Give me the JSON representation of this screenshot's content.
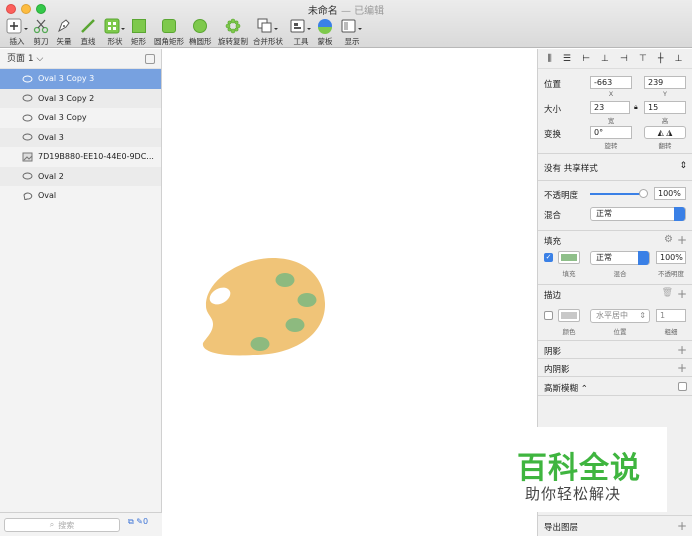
{
  "window": {
    "title": "未命名",
    "edited": "— 已编辑"
  },
  "toolbar": {
    "items": [
      "插入",
      "剪刀",
      "矢量",
      "直线",
      "形状",
      "矩形",
      "圆角矩形",
      "椭圆形",
      "旋转复制",
      "合并形状",
      "工具",
      "蒙板",
      "显示"
    ]
  },
  "layers": {
    "page": "页面 1",
    "items": [
      {
        "name": "Oval 3 Copy 3",
        "icon": "oval-icon",
        "selected": true
      },
      {
        "name": "Oval 3 Copy 2",
        "icon": "oval-icon"
      },
      {
        "name": "Oval 3 Copy",
        "icon": "oval-icon"
      },
      {
        "name": "Oval 3",
        "icon": "oval-icon"
      },
      {
        "name": "7D19B880-EE10-44E0-9DC...",
        "icon": "image-icon"
      },
      {
        "name": "Oval 2",
        "icon": "oval-icon"
      },
      {
        "name": "Oval",
        "icon": "oval-icon"
      }
    ],
    "search_placeholder": "搜索",
    "count": "0"
  },
  "inspector": {
    "position_label": "位置",
    "x": "-663",
    "y": "239",
    "x_label": "X",
    "y_label": "Y",
    "size_label": "大小",
    "width": "23",
    "height": "15",
    "w_label": "宽",
    "h_label": "高",
    "transform_label": "变换",
    "rotate": "0°",
    "rotate_label": "旋转",
    "flip_label": "翻转",
    "shared_style": "没有 共享样式",
    "opacity_label": "不透明度",
    "opacity": "100%",
    "opacity_fraction": 1.0,
    "blend_label": "混合",
    "blend": "正常",
    "fill_header": "填充",
    "fill_blend": "正常",
    "fill_opacity": "100%",
    "fill_color": "#8fbf8a",
    "fill_sub_fill": "填充",
    "fill_sub_blend": "混合",
    "fill_sub_opacity": "不透明度",
    "border_header": "描边",
    "border_pos": "水平居中",
    "border_width": "1",
    "border_sub_color": "颜色",
    "border_sub_pos": "位置",
    "border_sub_width": "粗细",
    "shadow": "阴影",
    "inner_shadow": "内阴影",
    "blur": "高斯模糊 ⌃",
    "export": "导出图层"
  },
  "canvas": {
    "palette_color": "#f0c478",
    "dot_color": "#8dba7f"
  },
  "watermark": {
    "line1": "百科全说",
    "line2": "助你轻松解决"
  }
}
